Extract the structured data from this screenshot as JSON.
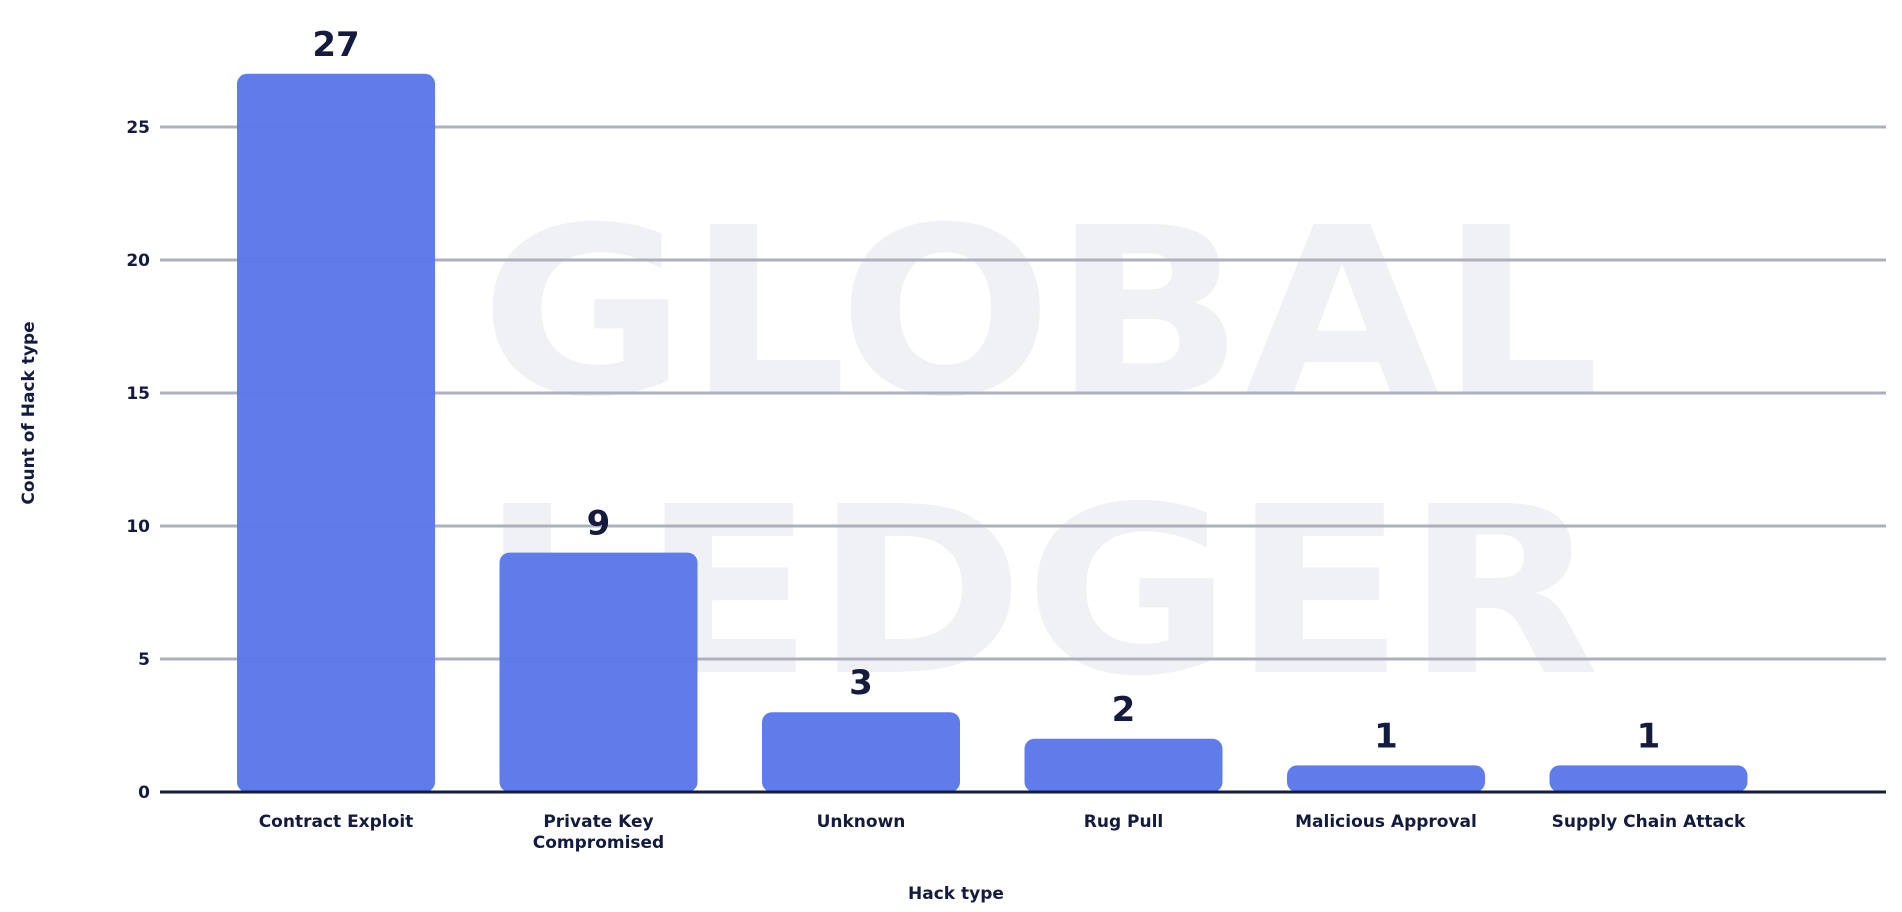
{
  "colors": {
    "bar": "#5B78EA",
    "text": "#141B3F",
    "grid": "#AEB0C0",
    "axis": "#141B3F",
    "watermark": "#F0F1F4"
  },
  "watermark": {
    "line1": "GLOBAL",
    "line2": "LEDGER"
  },
  "chart_data": {
    "type": "bar",
    "categories": [
      "Contract Exploit",
      "Private Key Compromised",
      "Unknown",
      "Rug Pull",
      "Malicious Approval",
      "Supply Chain Attack"
    ],
    "category_lines": [
      [
        "Contract Exploit"
      ],
      [
        "Private Key",
        "Compromised"
      ],
      [
        "Unknown"
      ],
      [
        "Rug Pull"
      ],
      [
        "Malicious Approval"
      ],
      [
        "Supply Chain Attack"
      ]
    ],
    "values": [
      27,
      9,
      3,
      2,
      1,
      1
    ],
    "xlabel": "Hack type",
    "ylabel": "Count of Hack type",
    "ylim": [
      0,
      27
    ],
    "yticks": [
      0,
      5,
      10,
      15,
      20,
      25
    ],
    "grid": true,
    "data_labels": true
  }
}
